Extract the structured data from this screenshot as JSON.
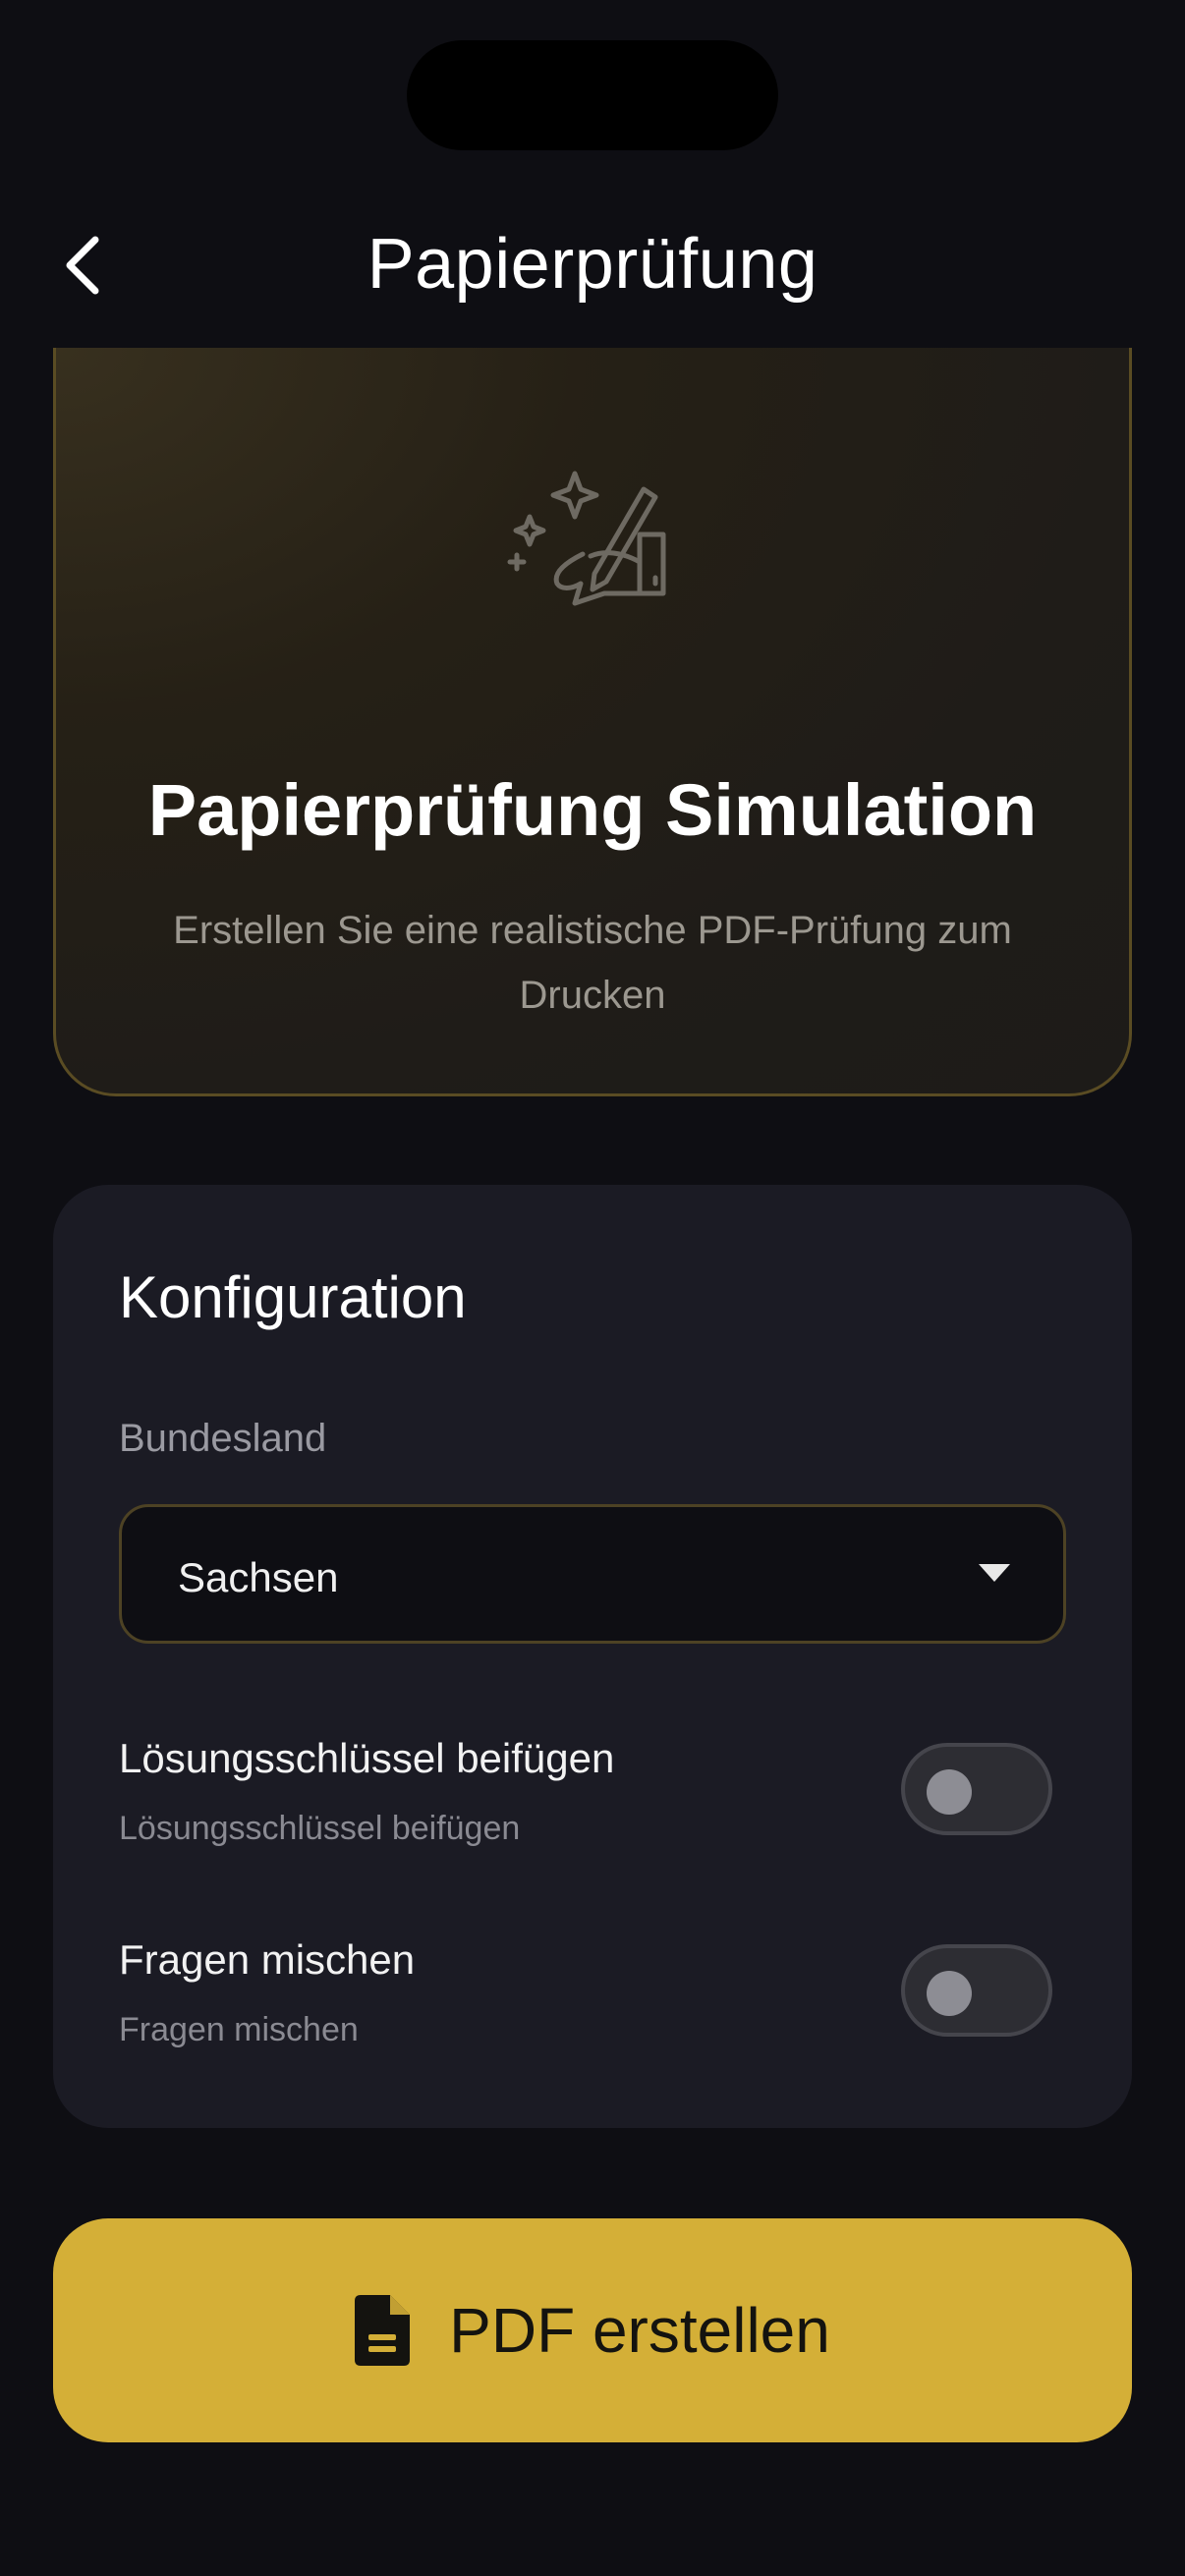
{
  "nav": {
    "title": "Papierprüfung"
  },
  "hero": {
    "title": "Papierprüfung Simulation",
    "subtitle": "Erstellen Sie eine realistische PDF-Prüfung zum Drucken"
  },
  "config": {
    "title": "Konfiguration",
    "state_label": "Bundesland",
    "state_value": "Sachsen",
    "options": [
      {
        "title": "Lösungsschlüssel beifügen",
        "subtitle": "Lösungsschlüssel beifügen",
        "enabled": false
      },
      {
        "title": "Fragen mischen",
        "subtitle": "Fragen mischen",
        "enabled": false
      }
    ]
  },
  "cta": {
    "label": "PDF erstellen"
  },
  "colors": {
    "background": "#0e0e13",
    "card": "#1b1b24",
    "accent": "#d4af37",
    "hero_border": "#5a4c23"
  },
  "icons": {
    "back": "chevron-left-icon",
    "hero": "hand-pen-sparkles-icon",
    "select": "caret-down-icon",
    "cta": "document-icon"
  }
}
